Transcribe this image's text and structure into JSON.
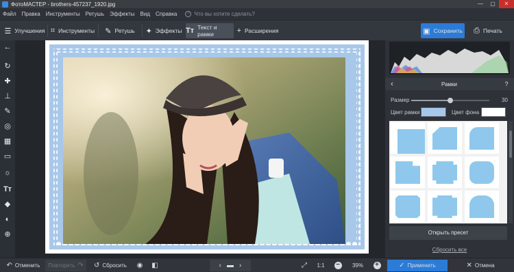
{
  "window": {
    "title": "ФотоМАСТЕР - brothers-457237_1920.jpg",
    "controls": [
      "—",
      "▢",
      "✕"
    ]
  },
  "menu": {
    "items": [
      "Файл",
      "Правка",
      "Инструменты",
      "Ретушь",
      "Эффекты",
      "Вид",
      "Справка"
    ],
    "search_placeholder": "Что вы хотите сделать?"
  },
  "toolbar": {
    "tabs": [
      {
        "label": "Улучшения",
        "icon": "sliders-icon"
      },
      {
        "label": "Инструменты",
        "icon": "crop-icon"
      },
      {
        "label": "Ретушь",
        "icon": "brush-icon"
      },
      {
        "label": "Эффекты",
        "icon": "magic-wand-icon"
      },
      {
        "label": "Текст и рамки",
        "icon": "text-frame-icon",
        "active": true
      },
      {
        "label": "Расширения",
        "icon": "plus-icon"
      }
    ],
    "save_label": "Сохранить",
    "print_label": "Печать",
    "accent_color": "#2c7bd6"
  },
  "left_tools": [
    "back-arrow-icon",
    "rotate-icon",
    "bandage-icon",
    "stamp-icon",
    "brush-icon",
    "target-icon",
    "gradient-icon",
    "vignette-icon",
    "sun-icon",
    "text-icon",
    "bucket-icon",
    "eraser-icon",
    "globe-icon"
  ],
  "panel": {
    "title": "Рамки",
    "help": "?",
    "size_label": "Размер",
    "size_value": "30",
    "size_fraction": 0.5,
    "frame_color_label": "Цвет рамки",
    "frame_color": "#a6c8ea",
    "bg_color_label": "Цвет фона",
    "bg_color": "#ffffff",
    "open_preset_label": "Открыть пресет",
    "reset_all_label": "Сбросить все"
  },
  "bottom": {
    "undo_label": "Отменить",
    "redo_label": "Повторить",
    "reset_label": "Сбросить",
    "ratio_label": "1:1",
    "zoom_value": "39%",
    "apply_label": "Применить",
    "cancel_label": "Отмена"
  }
}
